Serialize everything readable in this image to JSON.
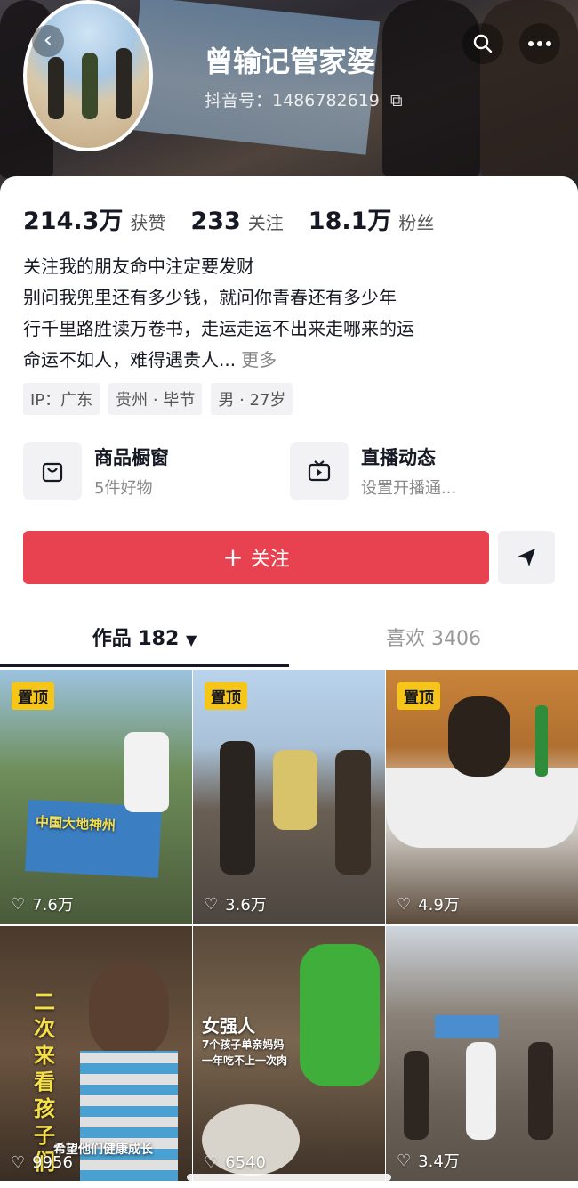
{
  "header": {
    "username": "曾输记管家婆",
    "account_id": "抖音号：1486782619",
    "icons": [
      "back-icon",
      "search-icon",
      "more-icon"
    ]
  },
  "stats": [
    {
      "value": "214.3万",
      "label": "获赞"
    },
    {
      "value": "233",
      "label": "关注"
    },
    {
      "value": "18.1万",
      "label": "粉丝"
    }
  ],
  "bio": {
    "lines": [
      "关注我的朋友命中注定要发财",
      "别问我兜里还有多少钱，就问你青春还有多少年",
      "行千里路胜读万卷书，走运走运不出来走哪来的运",
      " 命运不如人，难得遇贵人..."
    ],
    "more": "更多"
  },
  "tags": [
    "IP：广东",
    "贵州 · 毕节",
    "男 · 27岁"
  ],
  "services": [
    {
      "title": "商品橱窗",
      "subtitle": "5件好物",
      "icon": "shopping-bag-icon"
    },
    {
      "title": "直播动态",
      "subtitle": "设置开播通...",
      "icon": "tv-icon"
    }
  ],
  "actions": {
    "follow_label": "关注",
    "follow_color": "#e8414f"
  },
  "tabs": [
    {
      "label": "作品 182",
      "active": true
    },
    {
      "label": "喜欢 3406",
      "active": false
    }
  ],
  "videos": [
    {
      "pinned": "置顶",
      "likes": "7.6万",
      "overlay": ""
    },
    {
      "pinned": "置顶",
      "likes": "3.6万",
      "overlay": ""
    },
    {
      "pinned": "置顶",
      "likes": "4.9万",
      "overlay": ""
    },
    {
      "pinned": "",
      "likes": "9956",
      "overlay": "二次来看孩子们",
      "caption": "希望他们健康成长"
    },
    {
      "pinned": "",
      "likes": "6540",
      "overlay": "女强人",
      "sub1": "7个孩子单亲妈妈",
      "sub2": "一年吃不上一次肉"
    },
    {
      "pinned": "",
      "likes": "3.4万",
      "overlay": ""
    }
  ]
}
